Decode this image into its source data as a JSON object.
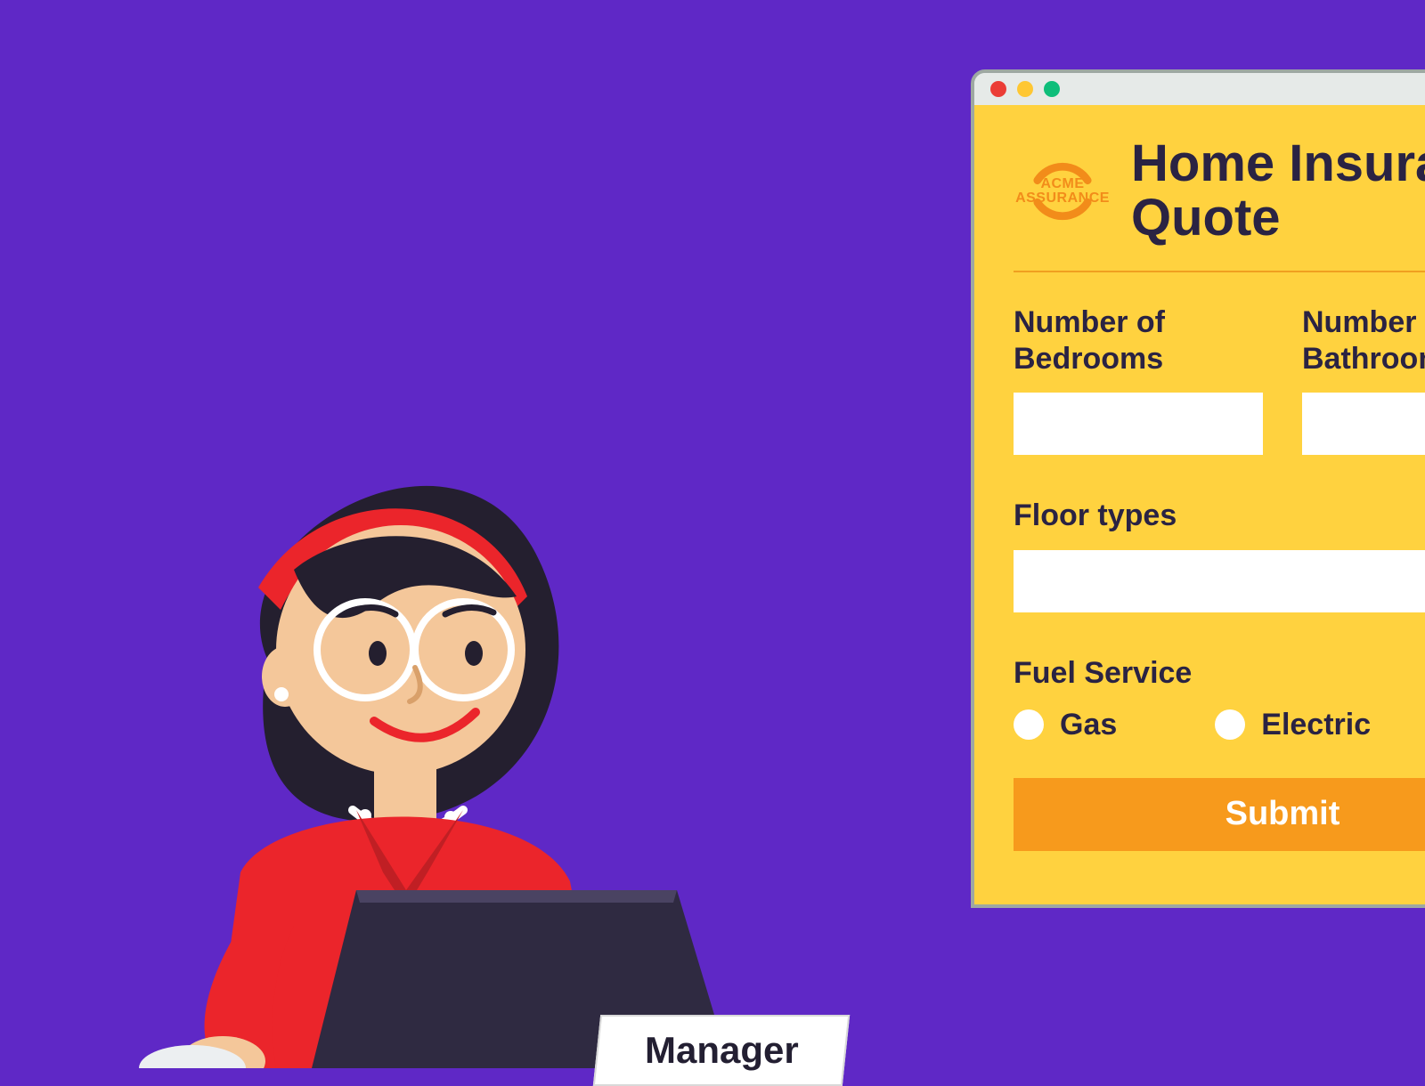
{
  "illustration": {
    "nameplate_label": "Manager"
  },
  "window": {
    "logo": {
      "line1": "ACME",
      "line2": "ASSURANCE"
    },
    "title": "Home Insurance Quote",
    "fields": {
      "bedrooms_label": "Number of Bedrooms",
      "bathrooms_label": "Number of Bathrooms",
      "floor_types_label": "Floor types",
      "fuel_label": "Fuel Service"
    },
    "fuel_options": {
      "gas": "Gas",
      "electric": "Electric"
    },
    "submit_label": "Submit"
  }
}
